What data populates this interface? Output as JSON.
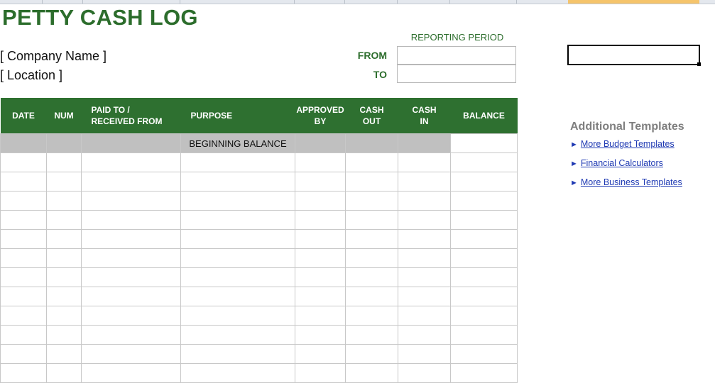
{
  "sheet": {
    "title": "PETTY CASH LOG",
    "company": "[ Company Name ]",
    "location": "[ Location ]"
  },
  "reporting_period": {
    "label": "REPORTING PERIOD",
    "from_label": "FROM",
    "to_label": "TO",
    "from_value": "",
    "to_value": ""
  },
  "ledger": {
    "headers": {
      "date": "DATE",
      "num": "NUM",
      "paid_to": "PAID TO /\nRECEIVED FROM",
      "purpose": "PURPOSE",
      "approved_by": "APPROVED\nBY",
      "cash_out": "CASH\nOUT",
      "cash_in": "CASH\nIN",
      "balance": "BALANCE"
    },
    "beginning_balance_label": "BEGINNING BALANCE"
  },
  "side_panel": {
    "title": "Additional Templates",
    "links": [
      "More Budget Templates",
      "Financial Calculators",
      "More Business Templates"
    ],
    "link_icon": "play-arrow-icon"
  },
  "colors": {
    "header_green": "#2e7030",
    "title_green": "#2c6d2c",
    "link_blue": "#1f3ab3",
    "beginning_row_gray": "#c0c0c0"
  }
}
